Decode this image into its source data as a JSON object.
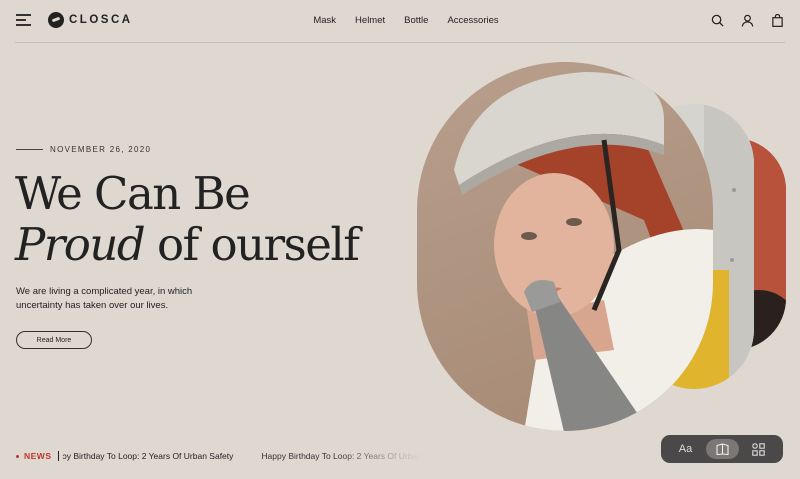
{
  "header": {
    "brand": "CLOSCA",
    "nav": [
      "Mask",
      "Helmet",
      "Bottle",
      "Accessories"
    ]
  },
  "hero": {
    "date": "NOVEMBER 26, 2020",
    "headline_line1": "We Can Be",
    "headline_italic": "Proud",
    "headline_rest": " of ourself",
    "description": "We are living a complicated year, in which uncertainty has taken over our lives.",
    "button_label": "Read More"
  },
  "ticker": {
    "label": "NEWS",
    "items": [
      "ɔy Birthday To Loop: 2 Years Of Urban Safety",
      "Happy Birthday To Loop: 2 Years Of Urban"
    ]
  },
  "toolbar": {
    "text_tool_label": "Aa"
  },
  "colors": {
    "background": "#dfd8d1",
    "accent_red": "#c0342c",
    "toolbar": "#4a4848"
  },
  "icons": [
    "menu-icon",
    "search-icon",
    "user-icon",
    "bag-icon",
    "book-icon",
    "grid-icon"
  ]
}
